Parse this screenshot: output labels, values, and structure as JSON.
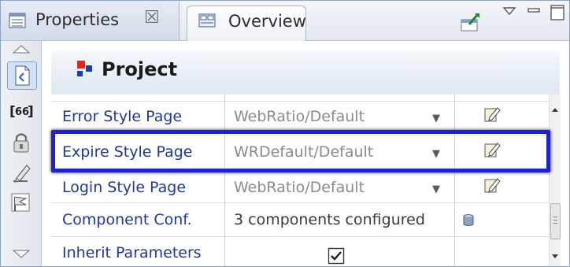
{
  "tabs": {
    "properties": {
      "label": "Properties",
      "close_glyph": "☒"
    },
    "overview": {
      "label": "Overview"
    }
  },
  "header": {
    "title": "Project"
  },
  "properties": [
    {
      "name": "Error Style Page",
      "value": "WebRatio/Default"
    },
    {
      "name": "Expire Style Page",
      "value": "WRDefault/Default"
    },
    {
      "name": "Login Style Page",
      "value": "WebRatio/Default"
    },
    {
      "name": "Component Conf.",
      "value": "3 components configured"
    },
    {
      "name": "Inherit Parameters",
      "checked": true
    }
  ],
  "icons": {
    "properties_tab": "properties-icon",
    "overview_tab": "overview-icon",
    "pin": "pin-icon",
    "view_menu": "view-menu-icon",
    "minimize": "minimize-icon",
    "maximize": "maximize-icon",
    "edit": "edit-icon",
    "component": "component-icon"
  },
  "colors": {
    "highlight": "#1f22cc",
    "label_text": "#20389a"
  }
}
